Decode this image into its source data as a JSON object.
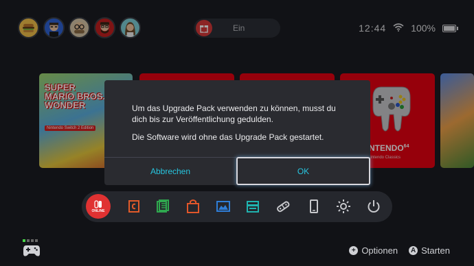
{
  "header": {
    "avatars": [
      "avatar-burger",
      "avatar-man-blue",
      "avatar-glasses",
      "avatar-red-beard",
      "avatar-woman"
    ],
    "online_label": "Ein",
    "time": "12:44",
    "battery": "100%",
    "battery_level": 1.0
  },
  "tiles": {
    "mario_logo_line1": "SUPER",
    "mario_logo_line2": "MARIO BROS.",
    "mario_logo_line3": "WONDER",
    "mario_subtitle": "Nintendo Switch 2 Edition",
    "n64_title": "NINTENDO",
    "n64_superscript": "64",
    "n64_subtitle": "Nintendo Classics"
  },
  "dialog": {
    "message": "Um das Upgrade Pack verwenden zu können, musst du dich bis zur Veröffentlichung gedulden.",
    "message2": "Die Software wird ohne das Upgrade Pack gestartet.",
    "cancel_label": "Abbrechen",
    "ok_label": "OK"
  },
  "dock": {
    "online_label": "ONLINE",
    "items": [
      "online-icon",
      "news-icon",
      "shop-list-icon",
      "eshop-icon",
      "album-icon",
      "chat-icon",
      "controllers-icon",
      "screen-icon",
      "settings-icon",
      "power-icon"
    ]
  },
  "footer": {
    "options_button": "+",
    "options_label": "Optionen",
    "start_button": "A",
    "start_label": "Starten"
  },
  "colors": {
    "accent_cyan": "#27c6e0",
    "nintendo_red": "#e60012",
    "background": "#1b1d22"
  }
}
